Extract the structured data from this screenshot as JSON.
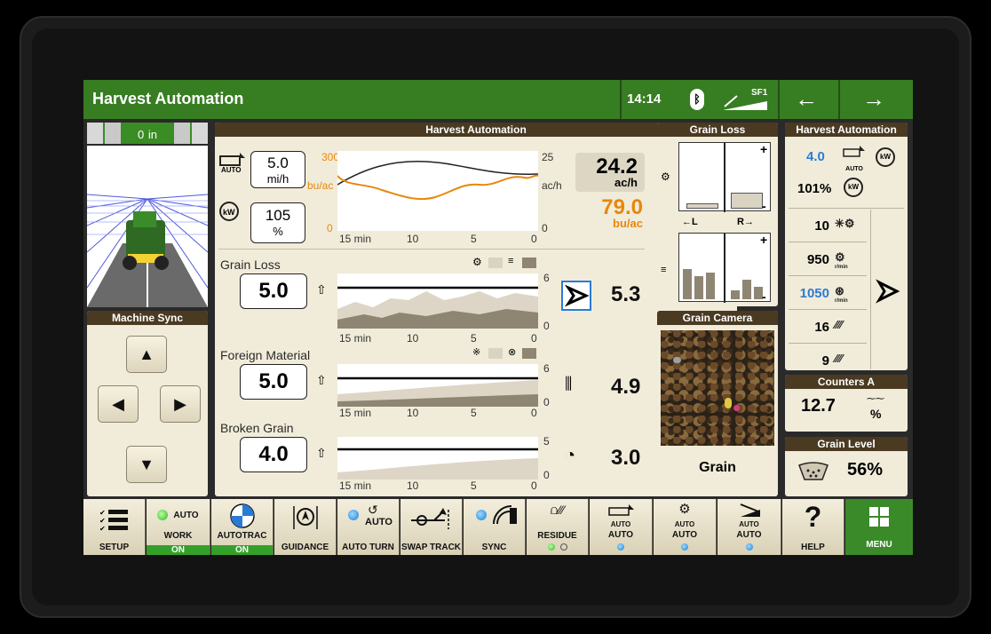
{
  "header": {
    "title": "Harvest Automation",
    "time": "14:14",
    "bluetooth_icon": "bluetooth-icon",
    "signal_label": "SF1",
    "back_icon": "arrow-left-icon",
    "forward_icon": "arrow-right-icon"
  },
  "gauge": {
    "value": "0",
    "unit": "in"
  },
  "machine_sync": {
    "title": "Machine Sync"
  },
  "harvest_panel": {
    "title": "Harvest Automation",
    "speed": {
      "value": "5.0",
      "unit": "mi/h"
    },
    "power": {
      "value": "105",
      "unit": "%"
    },
    "top_chart": {
      "left_top": "300",
      "left_unit": "bu/ac",
      "left_bottom": "0",
      "right_top": "25",
      "right_unit": "ac/h",
      "right_bottom": "0",
      "x_ticks": [
        "15 min",
        "10",
        "5",
        "0"
      ]
    },
    "area_rate": {
      "value": "24.2",
      "unit": "ac/h"
    },
    "yield": {
      "value": "79.0",
      "unit": "bu/ac"
    },
    "grain_loss": {
      "label": "Grain Loss",
      "setpoint": "5.0",
      "value": "5.3",
      "y_top": "6",
      "y_bottom": "0",
      "x_ticks": [
        "15 min",
        "10",
        "5",
        "0"
      ]
    },
    "foreign_material": {
      "label": "Foreign Material",
      "setpoint": "5.0",
      "value": "4.9",
      "y_top": "6",
      "y_bottom": "0",
      "x_ticks": [
        "15 min",
        "10",
        "5",
        "0"
      ]
    },
    "broken_grain": {
      "label": "Broken Grain",
      "setpoint": "4.0",
      "value": "3.0",
      "y_top": "5",
      "y_bottom": "0",
      "x_ticks": [
        "15 min",
        "10",
        "5",
        "0"
      ]
    }
  },
  "grain_loss_panel": {
    "title": "Grain Loss",
    "plus": "+",
    "minus": "-",
    "left_label": "←L",
    "right_label": "R→"
  },
  "grain_camera": {
    "title": "Grain Camera",
    "label": "Grain"
  },
  "ha_side": {
    "title": "Harvest Automation",
    "speed_value": "4.0",
    "auto_label": "AUTO",
    "power_value": "101%",
    "rows": [
      {
        "value": "10",
        "icon": "fan-icon"
      },
      {
        "value": "950",
        "icon": "rotor-icon",
        "unit": "r/min"
      },
      {
        "value": "1050",
        "icon": "fan-speed-icon",
        "unit": "r/min"
      },
      {
        "value": "16",
        "icon": "concave-icon"
      },
      {
        "value": "9",
        "icon": "sieve-icon"
      }
    ]
  },
  "counters": {
    "title": "Counters A",
    "value": "12.7",
    "unit": "%"
  },
  "grain_level": {
    "title": "Grain Level",
    "value": "56%"
  },
  "bottom_bar": {
    "setup": "SETUP",
    "work": {
      "top": "AUTO",
      "label": "WORK",
      "state": "ON"
    },
    "autotrac": {
      "label": "AUTOTRAC",
      "state": "ON"
    },
    "guidance": "GUIDANCE",
    "auto_turn": {
      "top": "AUTO",
      "label": "AUTO TURN"
    },
    "swap_track": "SWAP TRACK",
    "sync": "SYNC",
    "residue": "RESIDUE",
    "auto1": {
      "top": "AUTO",
      "label": "AUTO"
    },
    "auto2": {
      "top": "AUTO",
      "label": "AUTO"
    },
    "auto3": {
      "top": "AUTO",
      "label": "AUTO"
    },
    "help": "HELP",
    "help_glyph": "?",
    "menu": "MENU"
  }
}
